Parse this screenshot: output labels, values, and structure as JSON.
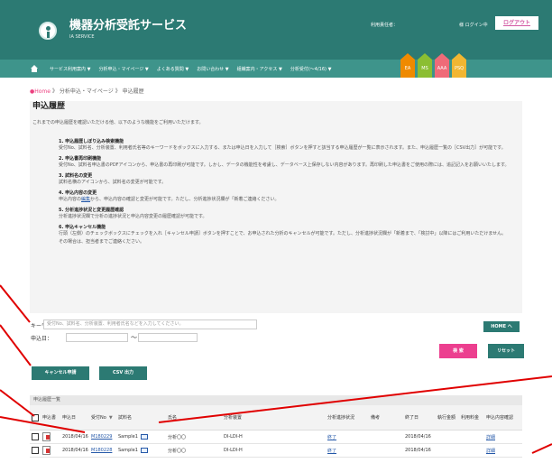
{
  "app": {
    "title": "機器分析受託サービス",
    "subtitle": "IA SERVICE",
    "user_label": "利用責任者：",
    "login_status": "様 ログイン中",
    "logout": "ログアウト"
  },
  "nav": {
    "items": [
      "サービス利用案内 ▼",
      "分析申込・マイページ ▼",
      "よくある質問 ▼",
      "お問い合わせ ▼",
      "組織案内・アクセス ▼",
      "分析受付(～4/16) ▼"
    ]
  },
  "tabs": [
    {
      "label": "EA",
      "color": "#ef8a00"
    },
    {
      "label": "MS",
      "color": "#8bbe32"
    },
    {
      "label": "AAA",
      "color": "#ef6b78"
    },
    {
      "label": "PSQ",
      "color": "#f2b632"
    }
  ],
  "breadcrumb": {
    "home": "●Home",
    "separator1": "》",
    "section": "分析申込・マイページ",
    "separator2": "》",
    "current": "申込履歴"
  },
  "page": {
    "title": "申込履歴",
    "intro": "これまでの申込履歴を確認いただける他、以下のような機能をご利用いただけます。"
  },
  "features": [
    {
      "title": "1. 申込履歴しぼり込み検索機能",
      "text": "受付No、試料名、分析装置、利用者氏名等のキーワードをボックスに入力する、または申込日を入力して［検索］ボタンを押すと該当する申込履歴が一覧に表示されます。また、申込履歴一覧の［CSV出力］が可能です。"
    },
    {
      "title": "2. 申込書再印刷機能",
      "text": "受付No、試料名申込書のPDFアイコンから、申込書の再印刷が可能です。しかし、データの機能性を考慮し、データベース上保存しない内容があります。再印刷した申込書をご使用の際には、追記記入をお願いいたします。"
    },
    {
      "title": "3. 試料名の変更",
      "text": "試料名横のアイコンから、試料名の変更が可能です。"
    },
    {
      "title": "4. 申込内容の変更",
      "text_before_link": "申込内容の",
      "link": "編集",
      "text_after_link": "から、申込内容の確認と変更が可能です。ただし、分析進捗状況欄が「新着",
      "text_rest": "ご連絡ください。"
    },
    {
      "title": "5. 分析進捗状況と変更履歴確認",
      "text": "分析進捗状況欄で分析の進捗状況と申込内容変更の履歴確認が可能です。"
    },
    {
      "title": "6. 申込キャンセル機能",
      "text": "行頭（左側）のチェックボックスにチェックを入れ［キャンセル申請］ボタンを押すことで、お申込された分析のキャンセルが可能です。ただし、分析進捗状況欄が「新着",
      "text_rest": "まで、「検討中」以降にはご利用いただけません。その場合は、担当者までご連絡ください。"
    }
  ],
  "home_button": "HOME ヘ",
  "search": {
    "keyword_label": "キーワード：",
    "keyword_placeholder": "受付No、試料名、分析装置、利用者氏名などを入力してください。",
    "date_label": "申込日：",
    "tilde": "～",
    "search": "検 索",
    "reset": "リセット"
  },
  "actions": {
    "cancel": "キャンセル申請",
    "csv": "CSV 出力"
  },
  "table": {
    "title": "申込履歴一覧",
    "headers": [
      "",
      "申込書",
      "申込日",
      "受付No",
      "試料名",
      "氏名",
      "分析装置",
      "分析進捗状況",
      "備考",
      "終了日",
      "執行金額",
      "利用料金",
      "申込内容確認"
    ],
    "rows": [
      {
        "date": "2018/04/16",
        "no": "M180229",
        "sample": "Sample1",
        "name": "分析〇〇",
        "device": "DI-LDI-H",
        "status": "終了",
        "end": "2018/04/16",
        "details": "詳細"
      },
      {
        "date": "2018/04/16",
        "no": "M180228",
        "sample": "Sample1",
        "name": "分析〇〇",
        "device": "DI-LDI-H",
        "status": "終了",
        "end": "2018/04/16",
        "details": "詳細"
      }
    ]
  }
}
